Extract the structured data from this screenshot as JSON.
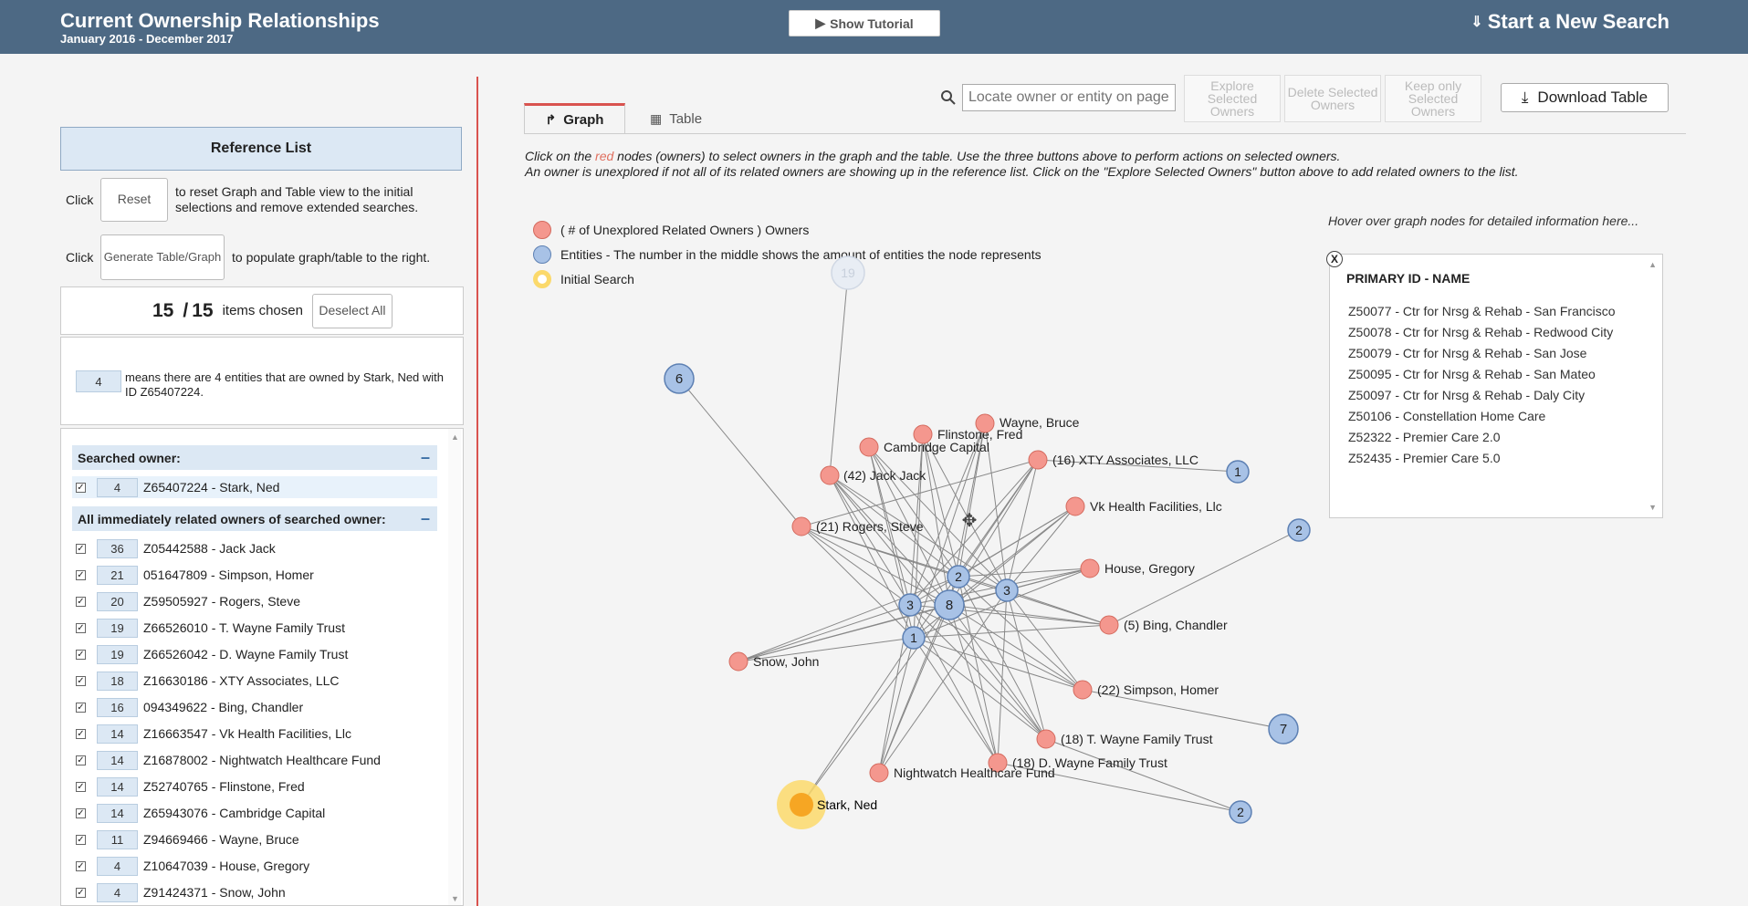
{
  "header": {
    "title": "Current Ownership Relationships",
    "subtitle": "January 2016 - December 2017",
    "tutorial_label": "Show Tutorial",
    "new_search_label": "Start a New Search"
  },
  "left": {
    "reference_title": "Reference List",
    "click_label": "Click",
    "reset_label": "Reset",
    "reset_desc": "to reset Graph and Table view to the initial selections and remove extended searches.",
    "generate_label": "Generate Table/Graph",
    "generate_desc": "to populate graph/table to the right.",
    "chosen_count": "15",
    "chosen_sep": "/",
    "total_count": "15",
    "chosen_label": "items chosen",
    "deselect_label": "Deselect All",
    "legend_num": "4",
    "legend_text": "means there are 4 entities that are owned by Stark, Ned with ID Z65407224.",
    "searched_header": "Searched owner:",
    "searched_owner": {
      "num": "4",
      "label": "Z65407224 - Stark, Ned"
    },
    "related_header": "All immediately related owners of searched owner:",
    "related": [
      {
        "num": "36",
        "label": "Z05442588 - Jack Jack"
      },
      {
        "num": "21",
        "label": "051647809 - Simpson, Homer"
      },
      {
        "num": "20",
        "label": "Z59505927 - Rogers, Steve"
      },
      {
        "num": "19",
        "label": "Z66526010 - T. Wayne Family Trust"
      },
      {
        "num": "19",
        "label": "Z66526042 - D. Wayne Family Trust"
      },
      {
        "num": "18",
        "label": "Z16630186 - XTY Associates, LLC"
      },
      {
        "num": "16",
        "label": "094349622 - Bing, Chandler"
      },
      {
        "num": "14",
        "label": "Z16663547 - Vk Health Facilities, Llc"
      },
      {
        "num": "14",
        "label": "Z16878002 - Nightwatch Healthcare Fund"
      },
      {
        "num": "14",
        "label": "Z52740765 - Flinstone, Fred"
      },
      {
        "num": "14",
        "label": "Z65943076 - Cambridge Capital"
      },
      {
        "num": "11",
        "label": "Z94669466 - Wayne, Bruce"
      },
      {
        "num": "4",
        "label": "Z10647039 - House, Gregory"
      },
      {
        "num": "4",
        "label": "Z91424371 - Snow, John"
      }
    ]
  },
  "right": {
    "tab_graph": "Graph",
    "tab_table": "Table",
    "search_placeholder": "Locate owner or entity on page",
    "explore_label": "Explore Selected Owners",
    "delete_label": "Delete Selected Owners",
    "keep_label": "Keep only Selected Owners",
    "download_label": "Download Table",
    "instr_1a": "Click on the ",
    "instr_1red": "red",
    "instr_1b": " nodes (owners) to select owners in the graph and the table. Use the three buttons above to perform actions on selected owners.",
    "instr_2": "An owner is unexplored if not all of its related owners are showing up in the reference list. Click on the \"Explore Selected Owners\" button above to add related owners to the list.",
    "legend_owners": "( # of Unexplored Related Owners ) Owners",
    "legend_entities": "Entities - The number in the middle shows the amount of entities the node represents",
    "legend_initial": "Initial Search",
    "hover_hint": "Hover over graph nodes for detailed information here...",
    "info_close": "X",
    "info_header": "PRIMARY ID - NAME",
    "info_items": [
      "Z50077 - Ctr for Nrsg & Rehab - San Francisco",
      "Z50078 - Ctr for Nrsg & Rehab - Redwood City",
      "Z50079 - Ctr for Nrsg & Rehab - San Jose",
      "Z50095 - Ctr for Nrsg & Rehab - San Mateo",
      "Z50097 - Ctr for Nrsg & Rehab - Daly City",
      "Z50106 - Constellation Home Care",
      "Z52322 - Premier Care 2.0",
      "Z52435 - Premier Care 5.0"
    ]
  },
  "graph": {
    "colors": {
      "owner": "#f4978e",
      "entity": "#a8c2e6",
      "initial": "#f6a623",
      "initial_halo": "#fbd96b",
      "edge": "#888888"
    },
    "owner_nodes": [
      {
        "id": "jack",
        "label": "(42) Jack Jack"
      },
      {
        "id": "rogers",
        "label": "(21) Rogers, Steve"
      },
      {
        "id": "snow",
        "label": "Snow, John"
      },
      {
        "id": "cambridge",
        "label": "Cambridge Capital"
      },
      {
        "id": "flinstone",
        "label": "Flinstone, Fred"
      },
      {
        "id": "wayne",
        "label": "Wayne, Bruce"
      },
      {
        "id": "xty",
        "label": "(16) XTY Associates, LLC"
      },
      {
        "id": "vk",
        "label": "Vk Health Facilities, Llc"
      },
      {
        "id": "house",
        "label": "House, Gregory"
      },
      {
        "id": "bing",
        "label": "(5) Bing, Chandler"
      },
      {
        "id": "simpson",
        "label": "(22) Simpson, Homer"
      },
      {
        "id": "twayne",
        "label": "(18) T. Wayne Family Trust"
      },
      {
        "id": "dwayne",
        "label": "(18) D. Wayne Family Trust"
      },
      {
        "id": "nightwatch",
        "label": "Nightwatch Healthcare Fund"
      }
    ],
    "initial_node": {
      "id": "stark",
      "label": "Stark, Ned"
    },
    "entity_nodes": [
      {
        "id": "e19",
        "label": "19",
        "faded": true
      },
      {
        "id": "e6",
        "label": "6"
      },
      {
        "id": "e8",
        "label": "8"
      },
      {
        "id": "e3a",
        "label": "3"
      },
      {
        "id": "e3b",
        "label": "3"
      },
      {
        "id": "e2c",
        "label": "2"
      },
      {
        "id": "e1c",
        "label": "1"
      },
      {
        "id": "e1r",
        "label": "1"
      },
      {
        "id": "e2r",
        "label": "2"
      },
      {
        "id": "e7",
        "label": "7"
      },
      {
        "id": "e2b",
        "label": "2"
      }
    ]
  }
}
